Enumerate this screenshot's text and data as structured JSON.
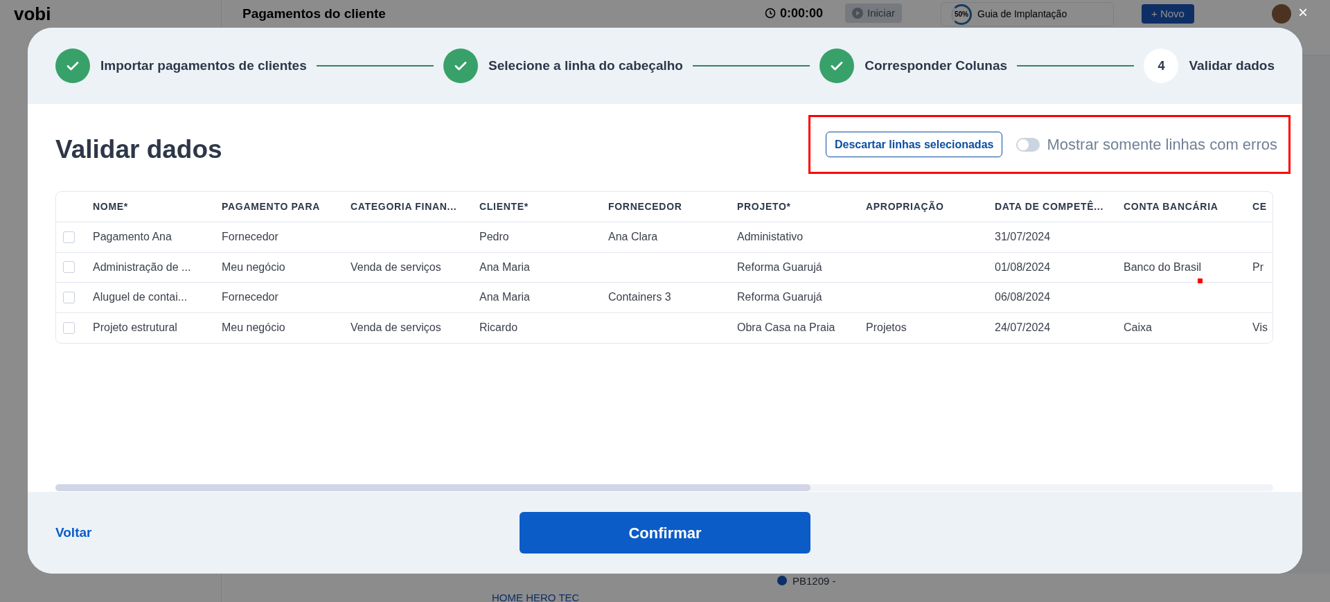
{
  "app": {
    "logo": "vobi",
    "page_title": "Pagamentos do cliente",
    "timer": "0:00:00",
    "start_button": "Iniciar",
    "guide": {
      "percent": "50%",
      "label": "Guia de Implantação"
    },
    "new_button": "+ Novo",
    "list_row": {
      "code": "PB1209 -",
      "client": "HOME HERO TEC"
    }
  },
  "close": "×",
  "steps": [
    {
      "label": "Importar pagamentos de clientes",
      "done": true
    },
    {
      "label": "Selecione a linha do cabeçalho",
      "done": true
    },
    {
      "label": "Corresponder Colunas",
      "done": true
    },
    {
      "label": "Validar dados",
      "done": false,
      "number": "4"
    }
  ],
  "title": "Validar dados",
  "discard_button": "Descartar linhas selecionadas",
  "error_filter": {
    "label": "Mostrar somente linhas com erros",
    "on": false
  },
  "table": {
    "columns": [
      "NOME*",
      "PAGAMENTO PARA",
      "CATEGORIA FINAN...",
      "CLIENTE*",
      "FORNECEDOR",
      "PROJETO*",
      "APROPRIAÇÃO",
      "DATA DE COMPETÊ...",
      "CONTA BANCÁRIA",
      "CE"
    ],
    "rows": [
      {
        "checked": false,
        "cells": [
          "Pagamento Ana",
          "Fornecedor",
          "",
          "Pedro",
          "Ana Clara",
          "Administativo",
          "",
          "31/07/2024",
          "",
          ""
        ]
      },
      {
        "checked": false,
        "cells": [
          "Administração de ...",
          "Meu negócio",
          "Venda de serviços",
          "Ana Maria",
          "",
          "Reforma Guarujá",
          "",
          "01/08/2024",
          "Banco do Brasil",
          "Pr"
        ]
      },
      {
        "checked": false,
        "cells": [
          "Aluguel de contai...",
          "Fornecedor",
          "",
          "Ana Maria",
          "Containers 3",
          "Reforma Guarujá",
          "",
          "06/08/2024",
          "",
          ""
        ]
      },
      {
        "checked": false,
        "cells": [
          "Projeto estrutural",
          "Meu negócio",
          "Venda de serviços",
          "Ricardo",
          "",
          "Obra Casa na Praia",
          "Projetos",
          "24/07/2024",
          "Caixa",
          "Vis"
        ]
      }
    ]
  },
  "back_link": "Voltar",
  "confirm_button": "Confirmar"
}
